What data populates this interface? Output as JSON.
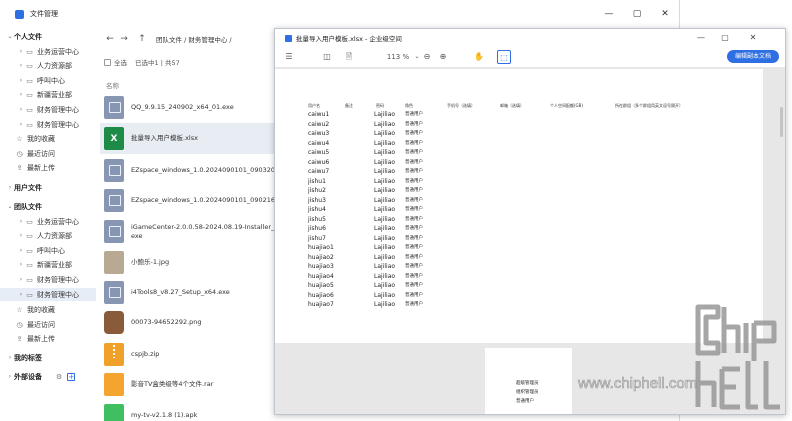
{
  "file_manager": {
    "title": "文件管理",
    "window_controls": [
      "—",
      "▢",
      "✕"
    ],
    "sidebar": [
      {
        "label": "个人文件",
        "type": "section",
        "chevron": "⌄"
      },
      {
        "label": "业务运营中心",
        "type": "folder",
        "chevron": "›"
      },
      {
        "label": "人力资源部",
        "type": "folder",
        "chevron": "›"
      },
      {
        "label": "呼叫中心",
        "type": "folder",
        "chevron": "›"
      },
      {
        "label": "新疆营业部",
        "type": "folder",
        "chevron": "›"
      },
      {
        "label": "财务管理中心",
        "type": "folder",
        "chevron": "›"
      },
      {
        "label": "财务管理中心",
        "type": "folder",
        "chevron": "›"
      },
      {
        "label": "我的收藏",
        "type": "link",
        "icon": "☆"
      },
      {
        "label": "最近访问",
        "type": "link",
        "icon": "◷"
      },
      {
        "label": "最新上传",
        "type": "link",
        "icon": "⇪"
      },
      {
        "label": "用户文件",
        "type": "section",
        "chevron": "›"
      },
      {
        "label": "团队文件",
        "type": "section",
        "chevron": "⌄"
      },
      {
        "label": "业务运营中心",
        "type": "folder",
        "chevron": "›"
      },
      {
        "label": "人力资源部",
        "type": "folder",
        "chevron": "›"
      },
      {
        "label": "呼叫中心",
        "type": "folder",
        "chevron": "›"
      },
      {
        "label": "新疆营业部",
        "type": "folder",
        "chevron": "›"
      },
      {
        "label": "财务管理中心",
        "type": "folder",
        "chevron": "›"
      },
      {
        "label": "财务管理中心",
        "type": "folder",
        "chevron": "›",
        "selected": true
      },
      {
        "label": "我的收藏",
        "type": "link",
        "icon": "☆"
      },
      {
        "label": "最近访问",
        "type": "link",
        "icon": "◷"
      },
      {
        "label": "最新上传",
        "type": "link",
        "icon": "⇪"
      },
      {
        "label": "我的标签",
        "type": "section",
        "chevron": "›"
      },
      {
        "label": "外部设备",
        "type": "section",
        "chevron": "›"
      }
    ],
    "nav": {
      "back": "←",
      "forward": "→",
      "up": "↑"
    },
    "breadcrumb": "团队文件 / 财务管理中心 /",
    "select_all": "全选",
    "selected_count": "已选中1 | 共57",
    "column_header": "名称",
    "files": [
      {
        "name": "QQ_9.9.15_240902_x64_01.exe",
        "kind": "exe"
      },
      {
        "name": "批量导入用户模板.xlsx",
        "kind": "xlsx",
        "selected": true
      },
      {
        "name": "EZspace_windows_1.0.2024090101_090320.exe",
        "kind": "exe"
      },
      {
        "name": "EZspace_windows_1.0.2024090101_090216.exe",
        "kind": "exe"
      },
      {
        "name": "iGameCenter-2.0.0.58-2024.08.19-Installer_Prod",
        "name2": "exe",
        "kind": "exe"
      },
      {
        "name": "小鲍乐-1.jpg",
        "kind": "img"
      },
      {
        "name": "i4Tools8_v8.27_Setup_x64.exe",
        "kind": "exe"
      },
      {
        "name": "00073-94652292.png",
        "kind": "png"
      },
      {
        "name": "cspjb.zip",
        "kind": "zip"
      },
      {
        "name": "影音TV盒类级等4个文件.rar",
        "kind": "rar"
      },
      {
        "name": "my-tv-v2.1.8 (1).apk",
        "kind": "apk"
      }
    ]
  },
  "preview": {
    "title": "批量导入用户模板.xlsx - 企业级空间",
    "window_controls": [
      "—",
      "▢",
      "✕"
    ],
    "zoom": "113 %",
    "zoom_out": "⊖",
    "zoom_in": "⊕",
    "edit_button": "编辑副本文档",
    "headers": [
      "用户名",
      "备注",
      "密码",
      "角色",
      "手机号（选填）",
      "邮箱（选填）",
      "个人空间配额(GB)",
      "所在群组（多个群组用英文逗号隔开）"
    ],
    "rows": [
      {
        "user": "caiwu1",
        "password": "Lajiliao",
        "role": "普通用户"
      },
      {
        "user": "caiwu2",
        "password": "Lajiliao",
        "role": "普通用户"
      },
      {
        "user": "caiwu3",
        "password": "Lajiliao",
        "role": "普通用户"
      },
      {
        "user": "caiwu4",
        "password": "Lajiliao",
        "role": "普通用户"
      },
      {
        "user": "caiwu5",
        "password": "Lajiliao",
        "role": "普通用户"
      },
      {
        "user": "caiwu6",
        "password": "Lajiliao",
        "role": "普通用户"
      },
      {
        "user": "caiwu7",
        "password": "Lajiliao",
        "role": "普通用户"
      },
      {
        "user": "jishu1",
        "password": "Lajiliao",
        "role": "普通用户"
      },
      {
        "user": "jishu2",
        "password": "Lajiliao",
        "role": "普通用户"
      },
      {
        "user": "jishu3",
        "password": "Lajiliao",
        "role": "普通用户"
      },
      {
        "user": "jishu4",
        "password": "Lajiliao",
        "role": "普通用户"
      },
      {
        "user": "jishu5",
        "password": "Lajiliao",
        "role": "普通用户"
      },
      {
        "user": "jishu6",
        "password": "Lajiliao",
        "role": "普通用户"
      },
      {
        "user": "jishu7",
        "password": "Lajiliao",
        "role": "普通用户"
      },
      {
        "user": "huajiao1",
        "password": "Lajiliao",
        "role": "普通用户"
      },
      {
        "user": "huajiao2",
        "password": "Lajiliao",
        "role": "普通用户"
      },
      {
        "user": "huajiao3",
        "password": "Lajiliao",
        "role": "普通用户"
      },
      {
        "user": "huajiao4",
        "password": "Lajiliao",
        "role": "普通用户"
      },
      {
        "user": "huajiao5",
        "password": "Lajiliao",
        "role": "普通用户"
      },
      {
        "user": "huajiao6",
        "password": "Lajiliao",
        "role": "普通用户"
      },
      {
        "user": "huajiao7",
        "password": "Lajiliao",
        "role": "普通用户"
      }
    ],
    "page2_lines": [
      "超级管理员",
      "组织管理员",
      "普通用户"
    ]
  },
  "watermark": {
    "site": "www.chiphell.com",
    "logo_text": "chiphell"
  },
  "colors": {
    "accent": "#2f6fe4",
    "excel_green": "#1e8b47",
    "selection": "#e7edf7"
  }
}
